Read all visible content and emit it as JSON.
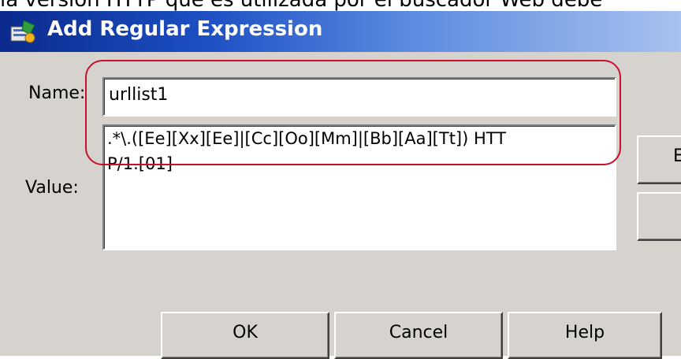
{
  "page_caption": "la versión HTTP que es utilizada por el buscador Web debe",
  "window": {
    "title": "Add Regular Expression",
    "icon": "regex-dialog-icon",
    "title_gradient": [
      "#0a2a8c",
      "#a7c2ee"
    ]
  },
  "form": {
    "name_label": "Name:",
    "name_value": "urllist1",
    "value_label": "Value:",
    "value_lines": [
      ".*\\.([Ee][Xx][Ee]|[Cc][Oo][Mm]|[Bb][Aa][Tt]) HTT",
      "P/1.[01]"
    ]
  },
  "side_buttons": [
    "E",
    ""
  ],
  "buttons": {
    "ok": "OK",
    "cancel": "Cancel",
    "help": "Help"
  },
  "highlight_color": "#c8102e"
}
